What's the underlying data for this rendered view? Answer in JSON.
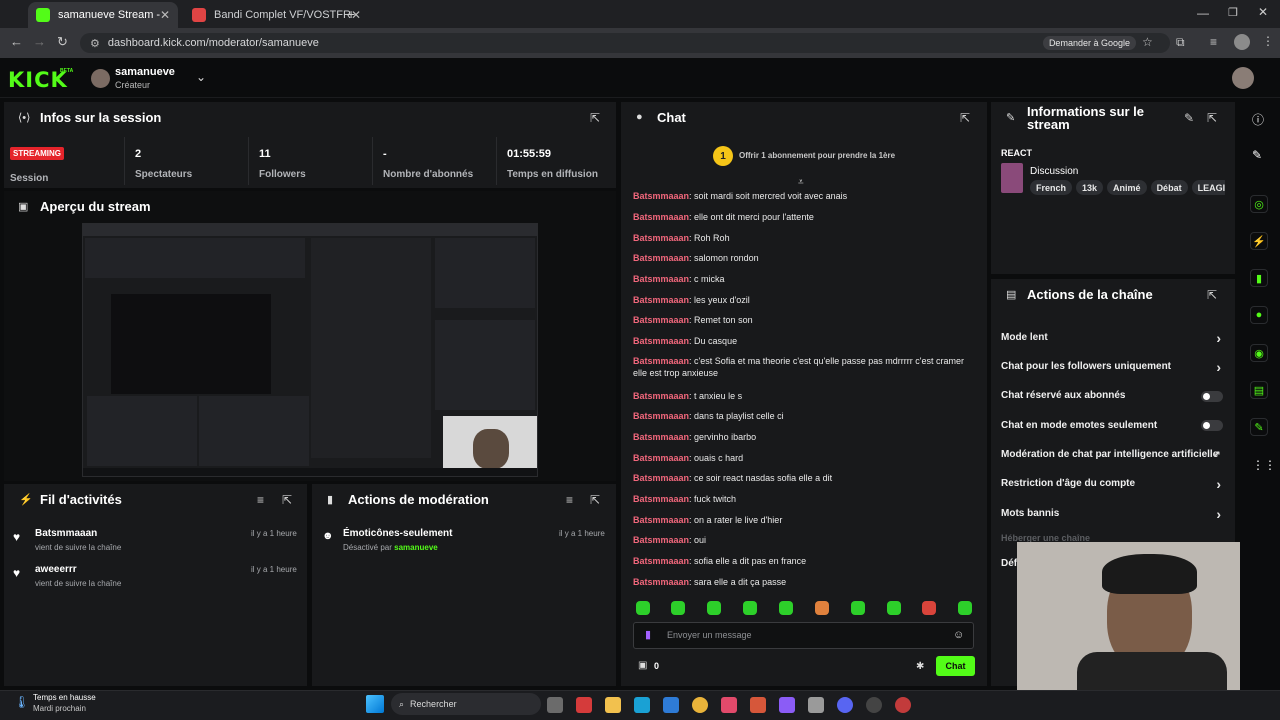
{
  "browser": {
    "tabs": [
      {
        "title": "samanueve Stream - Kick Dashb",
        "active": true
      },
      {
        "title": "Bandi Complet VF/VOSTFR",
        "active": false
      }
    ],
    "url": "dashboard.kick.com/moderator/samanueve",
    "ask_google": "Demander à Google"
  },
  "header": {
    "logo": "KICK",
    "logo_badge": "BETA",
    "user_name": "samanueve",
    "user_role": "Créateur"
  },
  "session": {
    "title": "Infos sur la session",
    "badge": "STREAMING",
    "badge_label": "Session",
    "stats": [
      {
        "value": "2",
        "label": "Spectateurs"
      },
      {
        "value": "11",
        "label": "Followers"
      },
      {
        "value": "-",
        "label": "Nombre d'abonnés"
      },
      {
        "value": "01:55:59",
        "label": "Temps en diffusion"
      }
    ]
  },
  "preview": {
    "title": "Aperçu du stream"
  },
  "activity": {
    "title": "Fil d'activités",
    "items": [
      {
        "user": "Batsmmaaan",
        "action": "vient de suivre la chaîne",
        "time": "il y a 1 heure"
      },
      {
        "user": "aweeerrr",
        "action": "vient de suivre la chaîne",
        "time": "il y a 1 heure"
      }
    ]
  },
  "moderation": {
    "title": "Actions de modération",
    "items": [
      {
        "label": "Émoticônes-seulement",
        "detail_prefix": "Désactivé par",
        "detail_user": "samanueve",
        "time": "il y a 1 heure"
      }
    ]
  },
  "chat": {
    "title": "Chat",
    "gift_count": "1",
    "gift_text": "Offrir 1 abonnement pour prendre la 1ère",
    "messages": [
      {
        "user": "Batsmmaaan",
        "text": "soit mardi soit mercred voit avec anais"
      },
      {
        "user": "Batsmmaaan",
        "text": "elle ont dit merci pour l'attente"
      },
      {
        "user": "Batsmmaaan",
        "text": "Roh Roh"
      },
      {
        "user": "Batsmmaaan",
        "text": "salomon rondon"
      },
      {
        "user": "Batsmmaaan",
        "text": "c micka"
      },
      {
        "user": "Batsmmaaan",
        "text": "les yeux d'ozil"
      },
      {
        "user": "Batsmmaaan",
        "text": "Remet ton son"
      },
      {
        "user": "Batsmmaaan",
        "text": "Du casque"
      },
      {
        "user": "Batsmmaaan",
        "text": "c'est Sofia et ma theorie c'est qu'elle passe pas mdrrrrr c'est cramer elle est trop anxieuse"
      },
      {
        "user": "Batsmmaaan",
        "text": "t anxieu le s"
      },
      {
        "user": "Batsmmaaan",
        "text": "dans ta playlist celle ci"
      },
      {
        "user": "Batsmmaaan",
        "text": "gervinho ibarbo"
      },
      {
        "user": "Batsmmaaan",
        "text": "ouais c hard"
      },
      {
        "user": "Batsmmaaan",
        "text": "ce soir react nasdas sofia elle a dit"
      },
      {
        "user": "Batsmmaaan",
        "text": "fuck twitch"
      },
      {
        "user": "Batsmmaaan",
        "text": "on a rater le live d'hier"
      },
      {
        "user": "Batsmmaaan",
        "text": "oui"
      },
      {
        "user": "Batsmmaaan",
        "text": "sofia elle a dit pas en france"
      },
      {
        "user": "Batsmmaaan",
        "text": "sara elle a dit ça passe"
      }
    ],
    "input_placeholder": "Envoyer un message",
    "points": "0",
    "send_label": "Chat"
  },
  "stream_info": {
    "title_line1": "Informations sur le",
    "title_line2": "stream",
    "category": "REACT",
    "stream_title": "Discussion",
    "tags": [
      "French",
      "13k",
      "Animé",
      "Débat",
      "LEAGI"
    ]
  },
  "channel_actions": {
    "title": "Actions de la chaîne",
    "items": [
      {
        "label": "Mode lent",
        "control": "chevron"
      },
      {
        "label": "Chat pour les followers uniquement",
        "control": "chevron"
      },
      {
        "label": "Chat réservé aux abonnés",
        "control": "toggle"
      },
      {
        "label": "Chat en mode emotes seulement",
        "control": "toggle"
      },
      {
        "label": "Modération de chat par intelligence artificielle",
        "control": "external"
      },
      {
        "label": "Restriction d'âge du compte",
        "control": "chevron"
      },
      {
        "label": "Mots bannis",
        "control": "chevron"
      }
    ],
    "host_label": "Héberger une chaîne",
    "partial_label": "Déf"
  },
  "taskbar": {
    "weather_title": "Temps en hausse",
    "weather_sub": "Mardi prochain",
    "search": "Rechercher"
  },
  "colors": {
    "brand": "#53fc18",
    "username": "#f2677c",
    "live": "#e5242b"
  }
}
